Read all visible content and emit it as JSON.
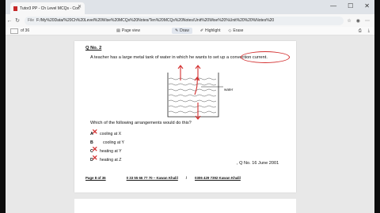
{
  "browser": {
    "tab_title": "Tutor3 PP - Ch Level MCQs - Con",
    "file_label": "File",
    "url": "F:/My%20Data/%20Ch%20Level%20Wise%20MCQs%20Notes/Ten%20MCQs%20Notes/Unit%20Wise%20%Unit%20%20%Notes%20",
    "minimize": "—",
    "maximize": "☐",
    "close": "✕"
  },
  "pdf_toolbar": {
    "page_of": "of 36",
    "page_view": "Page view",
    "draw": "Draw",
    "highlight": "Highlight",
    "erase": "Erase"
  },
  "question": {
    "number": "Q No. 2",
    "text": "A teacher has a large metal tank of water in which he wants to set up a convection current.",
    "water_label": "water",
    "prompt": "Which of the following arrangements would do this?",
    "options": [
      {
        "letter": "A",
        "text": "cooling at X"
      },
      {
        "letter": "B",
        "text": "cooling at Y"
      },
      {
        "letter": "C",
        "text": "heating at Y"
      },
      {
        "letter": "D",
        "text": "heating at Z"
      }
    ],
    "reference": ", Q No. 16 June 2001"
  },
  "footer": {
    "page": "Page 8 of 36",
    "contact": "0 33 55 66 77 70 – Kawan Khalil",
    "slash": "/",
    "contact2": "0306 429 7392 Kawan Khalil"
  },
  "colors": {
    "annotation_red": "#d32f2f",
    "viewer_bg": "#e8e8e8",
    "titlebar": "#dfe3e8"
  }
}
